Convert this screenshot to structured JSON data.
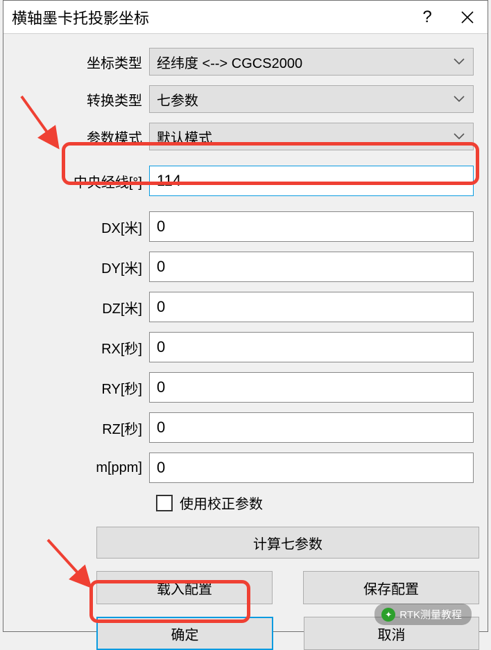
{
  "window": {
    "title": "横轴墨卡托投影坐标"
  },
  "selects": {
    "coord_type": {
      "label": "坐标类型",
      "value": "经纬度 <--> CGCS2000"
    },
    "trans_type": {
      "label": "转换类型",
      "value": "七参数"
    },
    "param_mode": {
      "label": "参数模式",
      "value": "默认模式"
    }
  },
  "fields": {
    "central_meridian": {
      "label": "中央经线[°]",
      "value": "114"
    },
    "dx": {
      "label": "DX[米]",
      "value": "0"
    },
    "dy": {
      "label": "DY[米]",
      "value": "0"
    },
    "dz": {
      "label": "DZ[米]",
      "value": "0"
    },
    "rx": {
      "label": "RX[秒]",
      "value": "0"
    },
    "ry": {
      "label": "RY[秒]",
      "value": "0"
    },
    "rz": {
      "label": "RZ[秒]",
      "value": "0"
    },
    "m": {
      "label": "m[ppm]",
      "value": "0"
    }
  },
  "checkbox": {
    "label": "使用校正参数",
    "checked": false
  },
  "buttons": {
    "calc": "计算七参数",
    "load": "载入配置",
    "save": "保存配置",
    "ok": "确定",
    "cancel": "取消"
  },
  "watermark": "RTK测量教程"
}
